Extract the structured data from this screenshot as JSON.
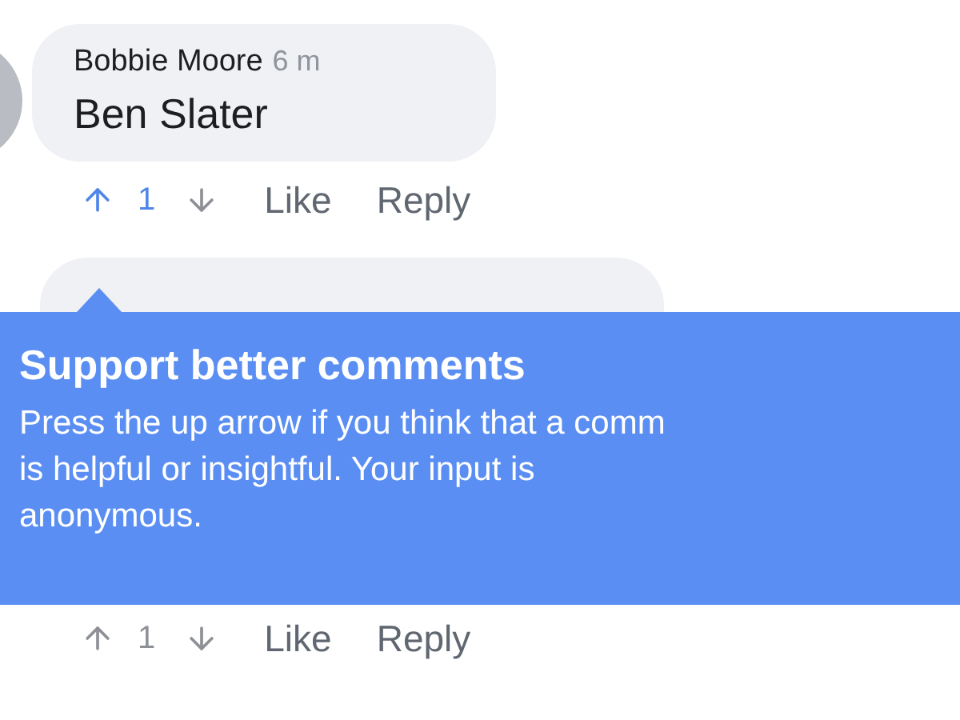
{
  "comments": [
    {
      "author": "Bobbie Moore",
      "time": "6 m",
      "text": "Ben Slater",
      "upvoted": true,
      "count": "1",
      "like": "Like",
      "reply": "Reply"
    },
    {
      "upvoted": false,
      "count": "1",
      "like": "Like",
      "reply": "Reply"
    }
  ],
  "tooltip": {
    "title": "Support better comments",
    "lines": [
      "Press the up arrow if you think that a comm",
      "is helpful or insightful. Your input is",
      "anonymous."
    ]
  }
}
